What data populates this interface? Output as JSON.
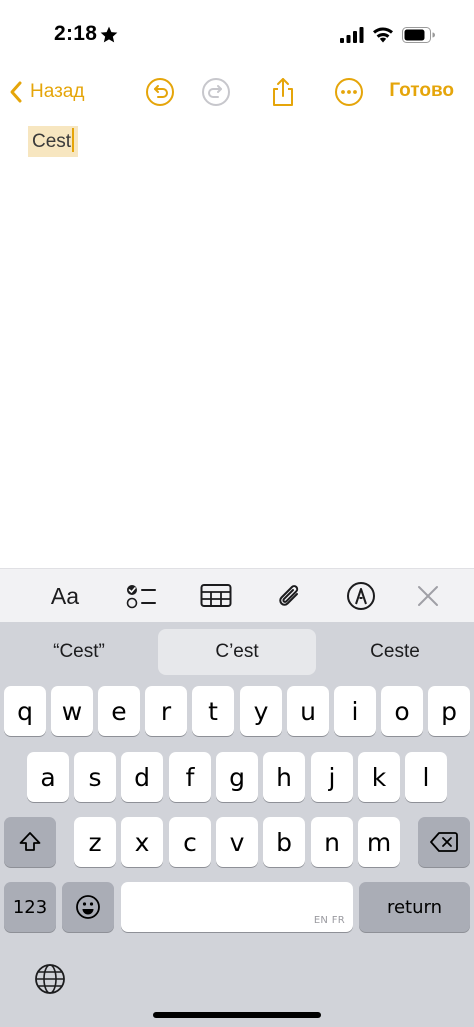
{
  "status_bar": {
    "time": "2:18",
    "star_icon": "star-icon",
    "signal_icon": "cellular-signal-icon",
    "wifi_icon": "wifi-icon",
    "battery_icon": "battery-icon"
  },
  "nav": {
    "back_label": "Назад",
    "done_label": "Готово",
    "accent_color": "#e5a50a",
    "icons": [
      "chevron-left-icon",
      "undo-icon",
      "redo-icon",
      "share-icon",
      "more-icon"
    ]
  },
  "note": {
    "text": "Cest"
  },
  "format_bar": {
    "aa_label": "Aa",
    "icons": [
      "text-format-icon",
      "checklist-icon",
      "table-icon",
      "attachment-icon",
      "markup-icon",
      "close-icon"
    ]
  },
  "keyboard": {
    "predictions": [
      "“Cest”",
      "C’est",
      "Ceste"
    ],
    "selected_prediction": "C’est",
    "row1": [
      "q",
      "w",
      "e",
      "r",
      "t",
      "y",
      "u",
      "i",
      "o",
      "p"
    ],
    "row2": [
      "a",
      "s",
      "d",
      "f",
      "g",
      "h",
      "j",
      "k",
      "l"
    ],
    "row3": [
      "z",
      "x",
      "c",
      "v",
      "b",
      "n",
      "m"
    ],
    "numbers_label": "123",
    "return_label": "return",
    "space_lang": "EN FR",
    "icons": [
      "shift-icon",
      "delete-icon",
      "emoji-icon",
      "globe-icon"
    ]
  }
}
